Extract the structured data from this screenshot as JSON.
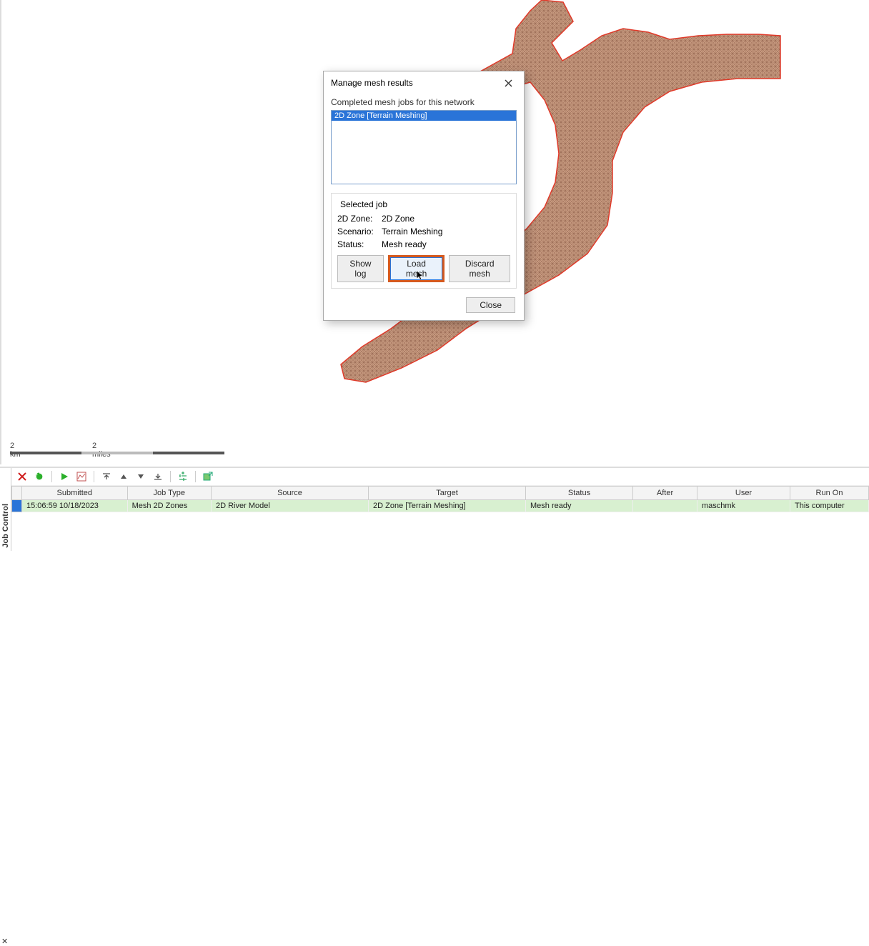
{
  "dialog": {
    "title": "Manage mesh results",
    "list_label": "Completed mesh jobs for this network",
    "list_item": "2D Zone [Terrain Meshing]",
    "group_title": "Selected job",
    "zone_label": "2D Zone:",
    "zone_value": "2D Zone",
    "scenario_label": "Scenario:",
    "scenario_value": "Terrain Meshing",
    "status_label": "Status:",
    "status_value": "Mesh ready",
    "show_log_btn": "Show log",
    "load_mesh_btn": "Load mesh",
    "discard_btn": "Discard mesh",
    "close_btn": "Close"
  },
  "scale": {
    "km": "2 km",
    "miles": "2 miles"
  },
  "panel": {
    "tab_label": "Job Control"
  },
  "grid": {
    "headers": {
      "submitted": "Submitted",
      "jobtype": "Job Type",
      "source": "Source",
      "target": "Target",
      "status": "Status",
      "after": "After",
      "user": "User",
      "runon": "Run On"
    },
    "row": {
      "submitted": "15:06:59 10/18/2023",
      "jobtype": "Mesh 2D Zones",
      "source": "2D River Model",
      "target": "2D Zone [Terrain Meshing]",
      "status": "Mesh ready",
      "after": "",
      "user": "maschmk",
      "runon": "This computer"
    }
  }
}
